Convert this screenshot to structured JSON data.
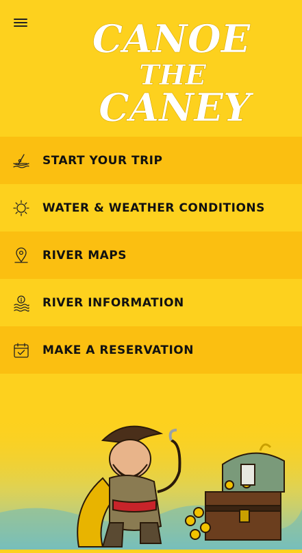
{
  "app": {
    "logo_line1": "CANOE",
    "logo_line2": "THE",
    "logo_line3": "CANEY"
  },
  "menu": {
    "items": [
      {
        "label": "START YOUR TRIP",
        "icon": "canoe-icon"
      },
      {
        "label": "WATER & WEATHER CONDITIONS",
        "icon": "sun-icon"
      },
      {
        "label": "RIVER MAPS",
        "icon": "map-pin-icon"
      },
      {
        "label": "RIVER INFORMATION",
        "icon": "info-water-icon"
      },
      {
        "label": "MAKE A RESERVATION",
        "icon": "calendar-check-icon"
      }
    ]
  },
  "colors": {
    "background": "#fdd11e",
    "alt_row": "#fbbf11",
    "text": "#111111"
  }
}
